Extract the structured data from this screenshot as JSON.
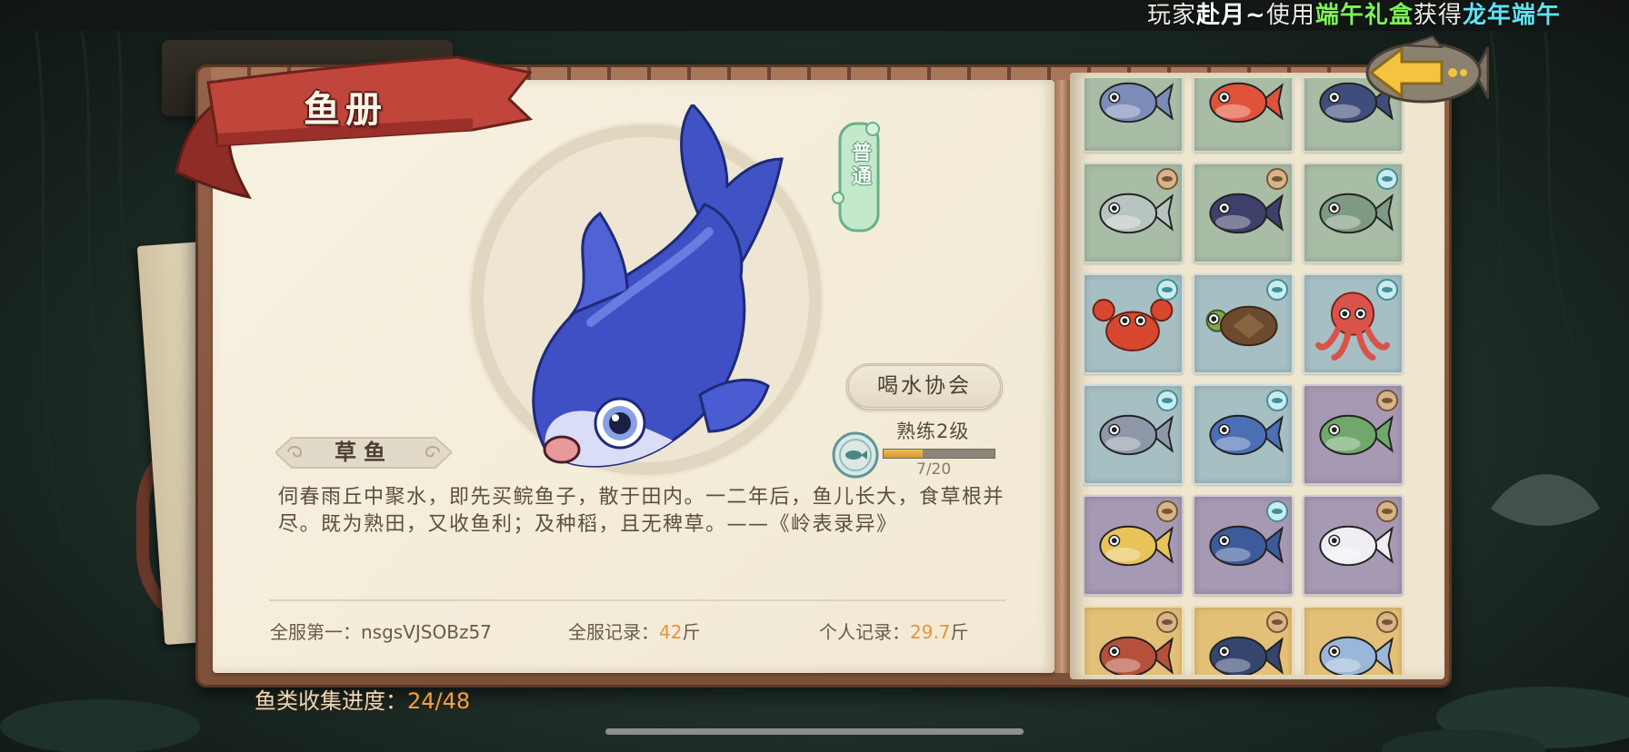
{
  "marquee": {
    "segments": [
      {
        "text": "玩家",
        "color": "#efece4"
      },
      {
        "text": "赴月~",
        "color": "#ffffff"
      },
      {
        "text": "使用",
        "color": "#efece4"
      },
      {
        "text": "端午礼盒",
        "color": "#7df25a"
      },
      {
        "text": "获得",
        "color": "#efece4"
      },
      {
        "text": "龙年端午",
        "color": "#5fe2f5"
      }
    ]
  },
  "header": {
    "title": "鱼册",
    "back_icon": "back-arrow-fish-icon"
  },
  "fish": {
    "name": "草鱼",
    "rarity": "普通",
    "tag": "喝水协会",
    "mastery_label": "熟练2级",
    "progress_text": "7/20",
    "progress_fraction": 0.35,
    "body_color": "#3f4fc4",
    "description": "伺春雨丘中聚水，即先买鲩鱼子，散于田内。一二年后，鱼儿长大，食草根并尽。既为熟田，又收鱼利；及种稻，且无稗草。——《岭表录异》"
  },
  "records": {
    "server_top_label": "全服第一：",
    "server_top_value": "nsgsVJSOBz57",
    "server_record_label": "全服记录：",
    "server_record_value": "42",
    "server_record_unit": "斤",
    "personal_label": "个人记录：",
    "personal_value": "29.7",
    "personal_unit": "斤"
  },
  "collection": {
    "label": "鱼类收集进度：",
    "value": "24/48"
  },
  "tiers": {
    "green": "#a9bca6",
    "teal": "#a6bfc3",
    "purple": "#a699b3",
    "gold": "#e3c077"
  },
  "fish_grid": [
    {
      "fish": "dolphin",
      "tier": "green",
      "badge": null,
      "color": "#7b8cb8"
    },
    {
      "fish": "red-carp",
      "tier": "green",
      "badge": null,
      "color": "#e0523a"
    },
    {
      "fish": "dark-fish",
      "tier": "green",
      "badge": null,
      "color": "#3f4d7a"
    },
    {
      "fish": "tuna",
      "tier": "green",
      "badge": "coin",
      "color": "#b8c4c0"
    },
    {
      "fish": "catfish",
      "tier": "green",
      "badge": "coin",
      "color": "#3e3f6a"
    },
    {
      "fish": "green-fish",
      "tier": "green",
      "badge": "eye",
      "color": "#7f9a82"
    },
    {
      "fish": "crab",
      "tier": "teal",
      "badge": "eye",
      "color": "#d8472f"
    },
    {
      "fish": "turtle",
      "tier": "teal",
      "badge": "eye",
      "color": "#7fa64a"
    },
    {
      "fish": "octopus",
      "tier": "teal",
      "badge": "eye",
      "color": "#d9534a"
    },
    {
      "fish": "sunfish",
      "tier": "teal",
      "badge": "eye",
      "color": "#8e98a8"
    },
    {
      "fish": "swordfish",
      "tier": "teal",
      "badge": "eye",
      "color": "#4a6fb5"
    },
    {
      "fish": "fish-in-bowl",
      "tier": "purple",
      "badge": "coin",
      "color": "#6fa86a"
    },
    {
      "fish": "red-lip-fish",
      "tier": "purple",
      "badge": "coin",
      "color": "#e8c35a"
    },
    {
      "fish": "armored-shark",
      "tier": "purple",
      "badge": "eye",
      "color": "#3d5a9a"
    },
    {
      "fish": "spirit-fox-fish",
      "tier": "purple",
      "badge": "coin",
      "color": "#f0eef2"
    },
    {
      "fish": "red-fish",
      "tier": "gold",
      "badge": "coin",
      "color": "#b5503a"
    },
    {
      "fish": "blue-whale",
      "tier": "gold",
      "badge": "coin",
      "color": "#35456e"
    },
    {
      "fish": "chubby-fish",
      "tier": "gold",
      "badge": "coin",
      "color": "#9ab6d8"
    }
  ]
}
